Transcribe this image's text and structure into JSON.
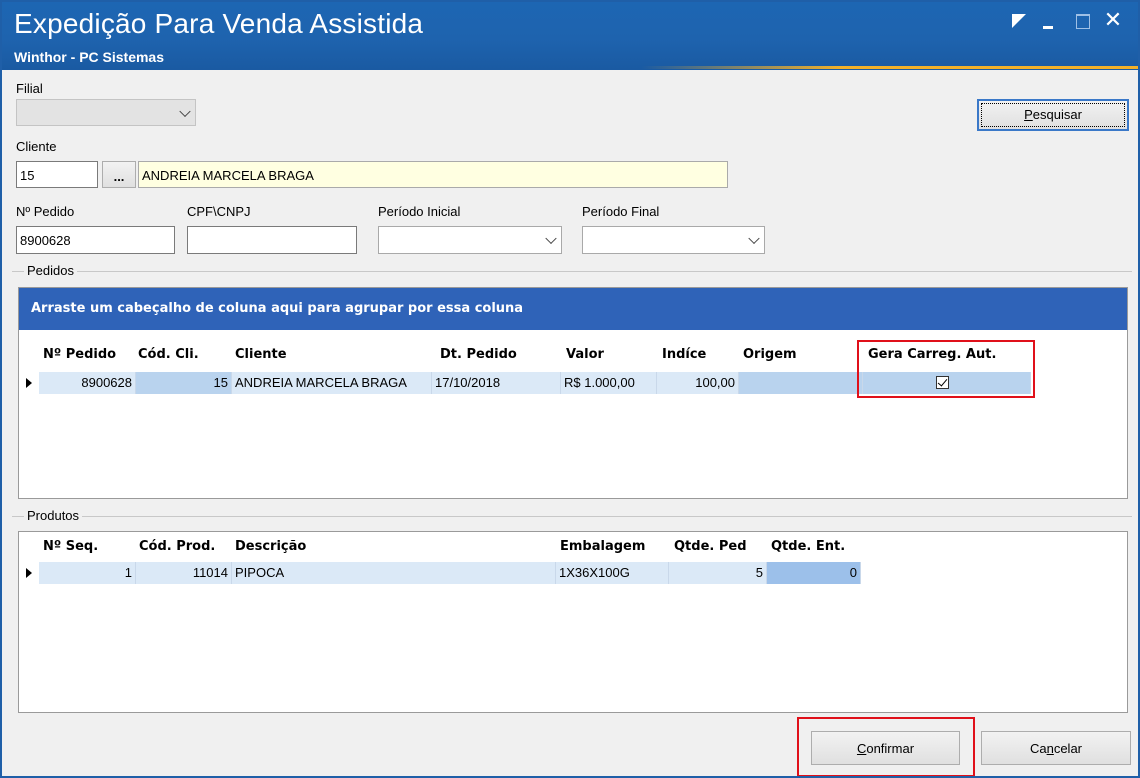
{
  "window": {
    "title": "Expedição Para Venda Assistida",
    "subtitle": "Winthor - PC Sistemas",
    "close_glyph": "✕"
  },
  "filters": {
    "filial_label": "Filial",
    "filial_value": "",
    "cliente_label": "Cliente",
    "cliente_code": "15",
    "lookup_button": "...",
    "cliente_name": "ANDREIA MARCELA BRAGA",
    "pedido_label": "Nº Pedido",
    "pedido_value": "8900628",
    "cpf_label": "CPF\\CNPJ",
    "cpf_value": "",
    "periodo_inicial_label": "Período Inicial",
    "periodo_final_label": "Período Final",
    "search_button_accel": "P",
    "search_button_rest": "esquisar"
  },
  "pedidos": {
    "group_label": "Pedidos",
    "group_band": "Arraste um cabeçalho de coluna aqui para agrupar por essa coluna",
    "columns": [
      "Nº Pedido",
      "Cód. Cli.",
      "Cliente",
      "Dt. Pedido",
      "Valor",
      "Indíce",
      "Origem",
      "Gera Carreg. Aut."
    ],
    "rows": [
      {
        "pedido": "8900628",
        "cod_cli": "15",
        "cliente": "ANDREIA MARCELA BRAGA",
        "dt_pedido": "17/10/2018",
        "valor": "R$ 1.000,00",
        "indice": "100,00",
        "origem": "",
        "gera_carreg": true
      }
    ]
  },
  "produtos": {
    "group_label": "Produtos",
    "columns": [
      "Nº Seq.",
      "Cód. Prod.",
      "Descrição",
      "Embalagem",
      "Qtde. Ped",
      "Qtde. Ent."
    ],
    "rows": [
      {
        "seq": "1",
        "cod_prod": "11014",
        "descricao": "PIPOCA",
        "embalagem": "1X36X100G",
        "qtde_ped": "5",
        "qtde_ent": "0"
      }
    ]
  },
  "actions": {
    "confirm_accel": "C",
    "confirm_rest": "onfirmar",
    "cancel_pre": "Ca",
    "cancel_accel": "n",
    "cancel_rest": "celar"
  },
  "colors": {
    "titlebar": "#1e63ae",
    "group_band": "#2f63b8",
    "selected_row": "#b9d3ee",
    "highlight": "#e0101a",
    "client_name_bg": "#ffffe1"
  }
}
